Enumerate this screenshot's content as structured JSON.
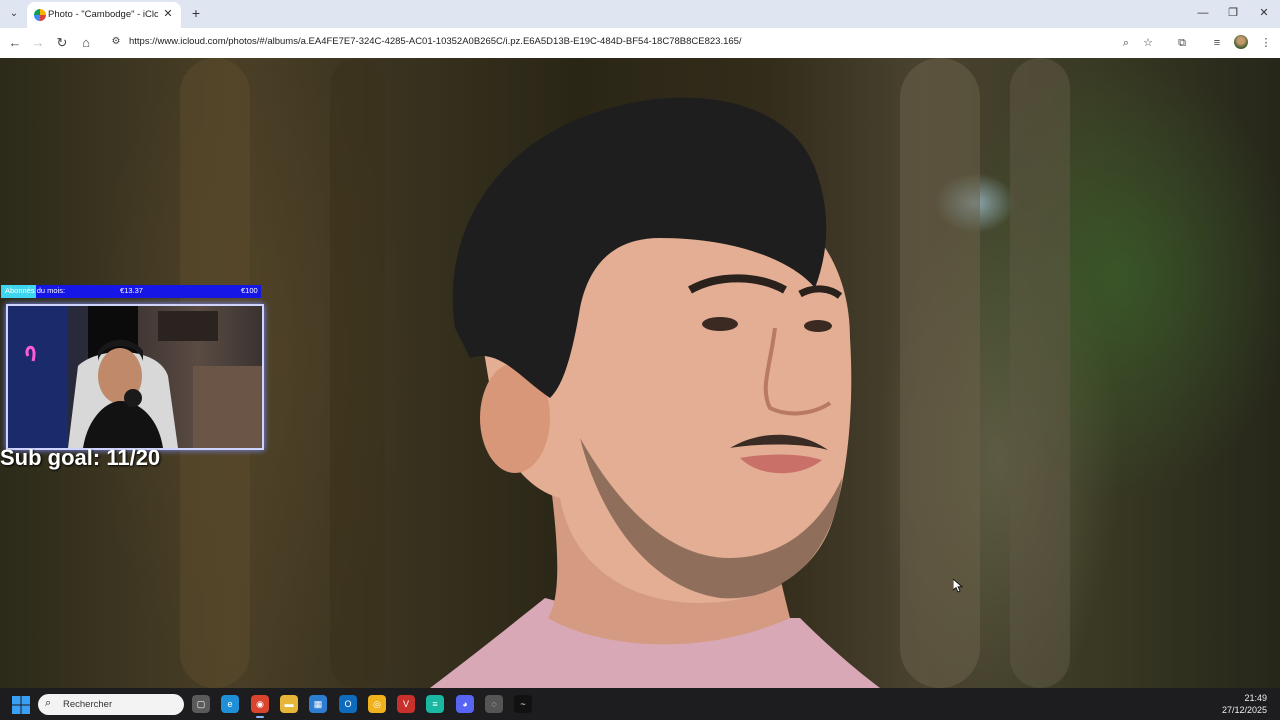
{
  "browser": {
    "tab": {
      "title": "Photo - \"Cambodge\" - iCloud Photos",
      "favicon": "icloud-photos-icon"
    },
    "tab_list_icon": "⌄",
    "tab_close_icon": "✕",
    "new_tab_icon": "+",
    "window_controls": {
      "minimize": "—",
      "restore": "❐",
      "close": "✕"
    },
    "nav": {
      "back": "←",
      "forward": "→",
      "reload": "↻",
      "home": "⌂"
    },
    "site_info_icon": "⚙",
    "url": "https://www.icloud.com/photos/#/albums/a.EA4FE7E7-324C-4285-AC01-10352A0B265C/i.pz.E6A5D13B-E19C-484D-BF54-18C78B8CE823.165/",
    "toolbar_icons": {
      "zoom": "⌕",
      "bookmark": "☆",
      "extensions": "⧉",
      "reading_list": "≡",
      "menu": "⋮"
    }
  },
  "overlay": {
    "goal_label": "Abonnés du mois:",
    "goal_current": "€13.37",
    "goal_target": "€100",
    "goal_progress": 0.1337,
    "goal_bar_color": "#1616e6",
    "goal_fill_color": "#3fd5f0",
    "sub_goal": "Sub goal: 11/20"
  },
  "taskbar": {
    "search_placeholder": "Rechercher",
    "search_icon": "⌕",
    "apps": [
      {
        "name": "task-view",
        "color": "#5a5a5a",
        "glyph": "▢"
      },
      {
        "name": "edge",
        "color": "#1f8fd8",
        "glyph": "e"
      },
      {
        "name": "chrome",
        "color": "#d9442f",
        "glyph": "◉",
        "active": true
      },
      {
        "name": "file-explorer",
        "color": "#e5b637",
        "glyph": "▬"
      },
      {
        "name": "store",
        "color": "#2d7dd2",
        "glyph": "▦"
      },
      {
        "name": "outlook",
        "color": "#0f6cbd",
        "glyph": "O"
      },
      {
        "name": "app-yellow",
        "color": "#f0b21c",
        "glyph": "◎"
      },
      {
        "name": "voicemeeter",
        "color": "#c8312b",
        "glyph": "V"
      },
      {
        "name": "app-teal",
        "color": "#1ab7a2",
        "glyph": "≡"
      },
      {
        "name": "discord",
        "color": "#5865f2",
        "glyph": "◕"
      },
      {
        "name": "app-circle",
        "color": "#555555",
        "glyph": "◌"
      },
      {
        "name": "app-dark",
        "color": "#111111",
        "glyph": "~"
      }
    ],
    "time": "21:49",
    "date": "27/12/2025"
  }
}
